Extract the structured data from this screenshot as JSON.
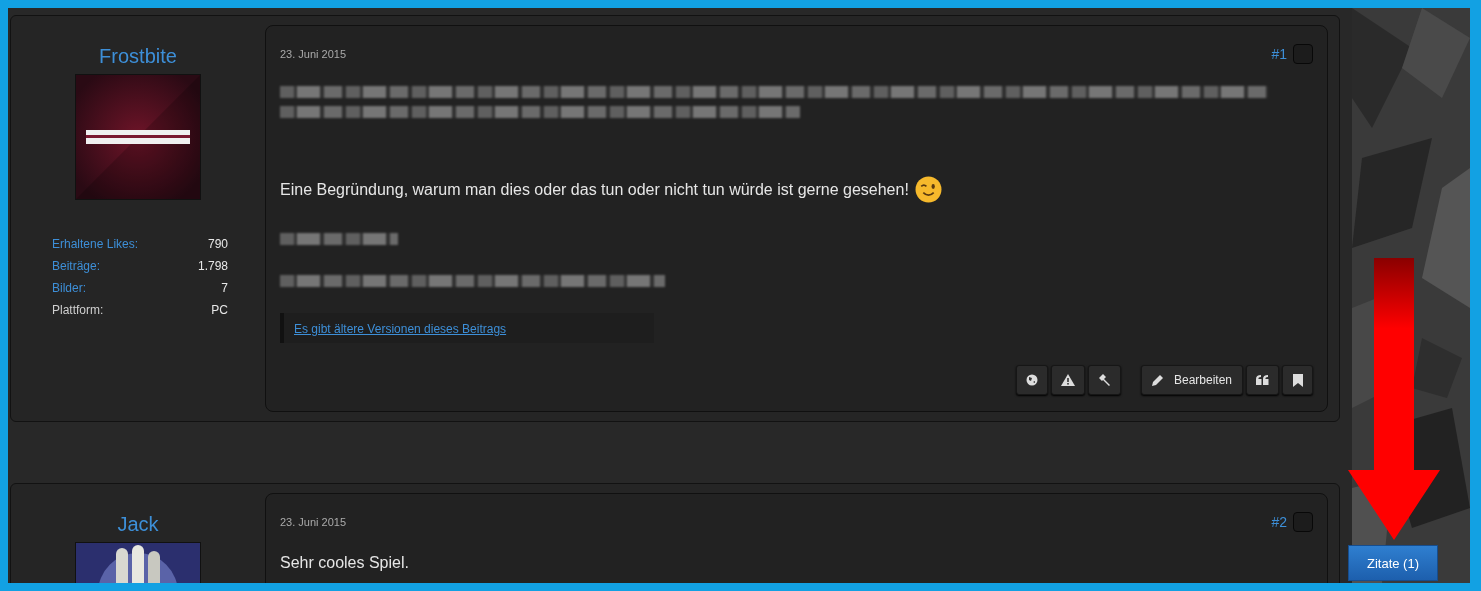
{
  "posts": [
    {
      "author": "Frostbite",
      "avatar": {
        "kind": "picture"
      },
      "stats": [
        {
          "label": "Erhaltene Likes:",
          "value": "790",
          "link": true
        },
        {
          "label": "Beiträge:",
          "value": "1.798",
          "link": true
        },
        {
          "label": "Bilder:",
          "value": "7",
          "link": true
        },
        {
          "label": "Plattform:",
          "value": "PC",
          "link": false
        }
      ],
      "date": "23. Juni 2015",
      "number": "#1",
      "selected": false,
      "body": [
        {
          "kind": "blurred-paragraph"
        },
        {
          "kind": "text-emoji",
          "text": "Eine Begründung, warum man dies oder das tun oder nicht tun würde ist gerne gesehen!"
        },
        {
          "kind": "blurred-short"
        },
        {
          "kind": "blurred-medium"
        }
      ],
      "history_link": "Es gibt ältere Versionen dieses Beitrags",
      "action_groups": [
        [
          {
            "kind": "globe"
          },
          {
            "kind": "warning"
          },
          {
            "kind": "hammer"
          }
        ],
        [
          {
            "kind": "edit",
            "label": "Bearbeiten"
          },
          {
            "kind": "quote"
          },
          {
            "kind": "bookmark"
          }
        ]
      ]
    },
    {
      "author": "Jack",
      "avatar": {
        "kind": "picture"
      },
      "date": "23. Juni 2015",
      "number": "#2",
      "selected": false,
      "body": [
        {
          "kind": "text",
          "text": "Sehr cooles Spiel."
        }
      ]
    }
  ],
  "quote_button": {
    "label": "Zitate (1)"
  }
}
